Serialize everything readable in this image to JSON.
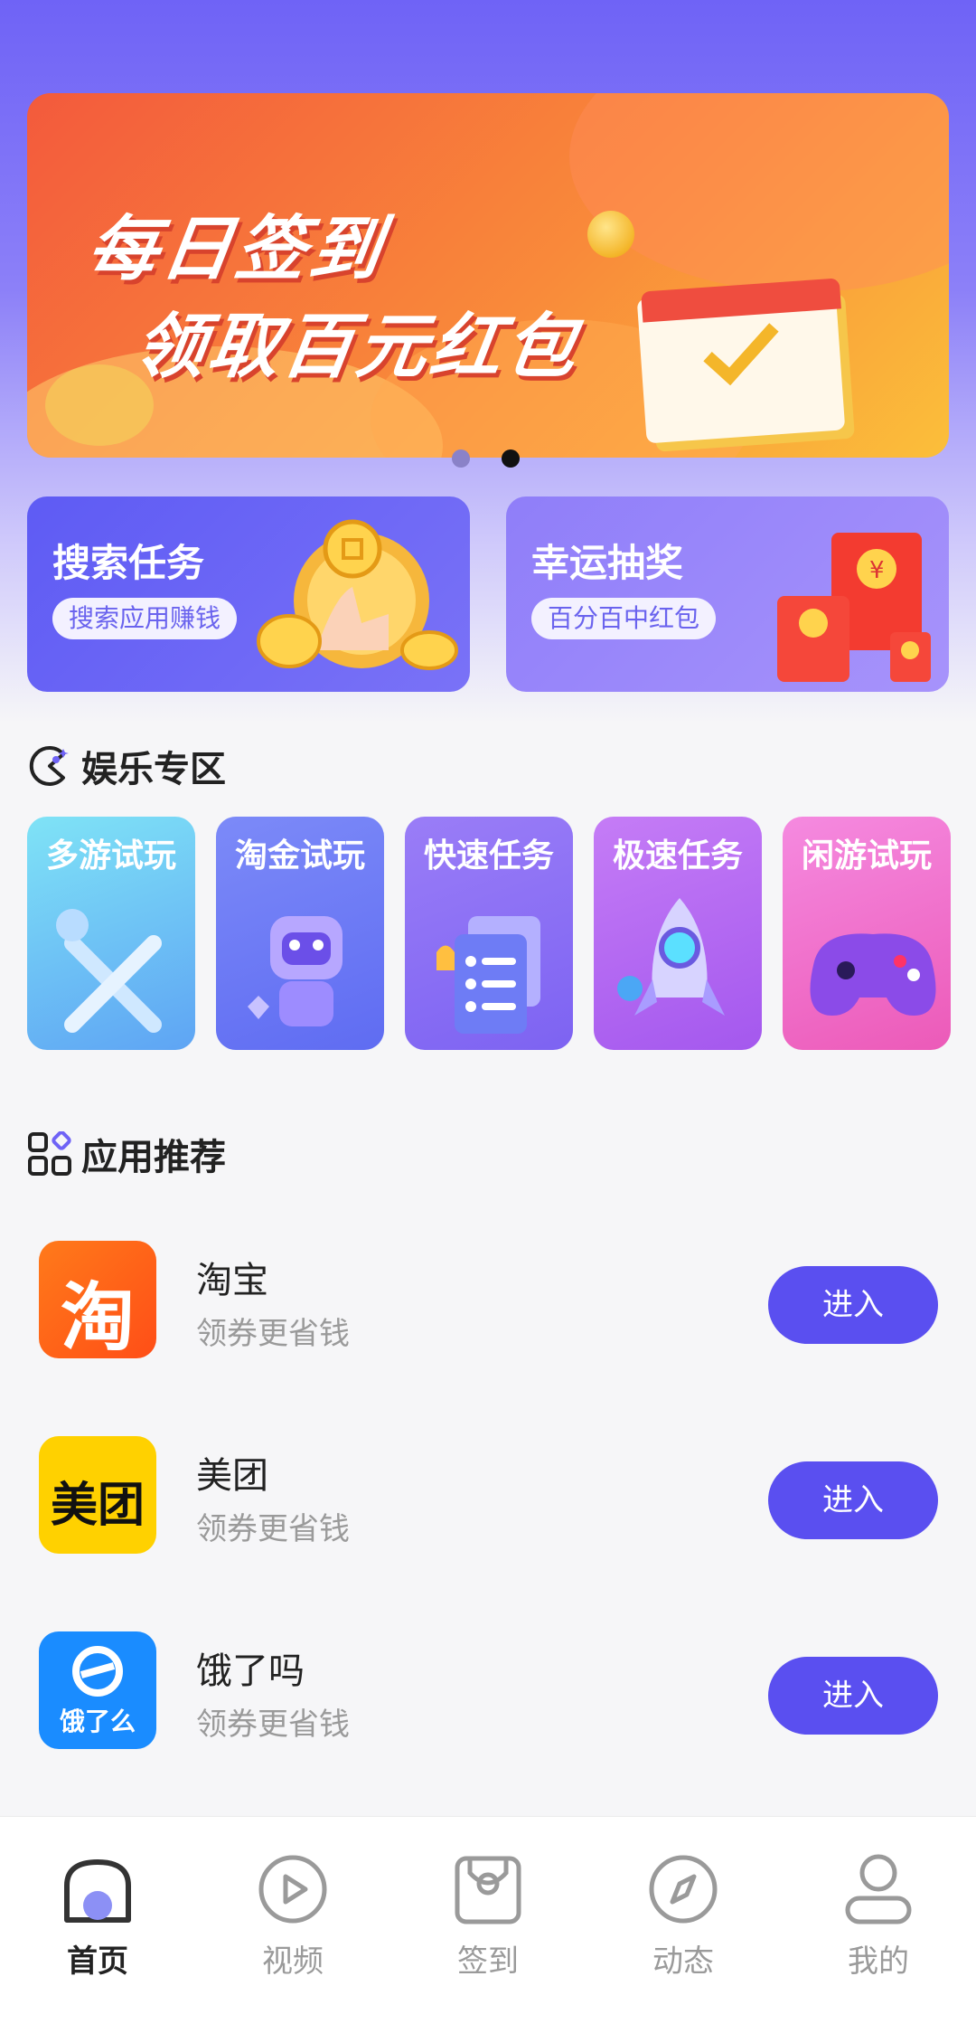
{
  "banner": {
    "line1": "每日签到",
    "line2": "领取百元红包",
    "pages": 2,
    "active_page": 2
  },
  "features": [
    {
      "title": "搜索任务",
      "pill": "搜索应用赚钱"
    },
    {
      "title": "幸运抽奖",
      "pill": "百分百中红包"
    }
  ],
  "entertainment": {
    "title": "娱乐专区",
    "tiles": [
      {
        "label": "多游试玩",
        "icon": "crossed-swords-icon"
      },
      {
        "label": "淘金试玩",
        "icon": "robot-mascot-icon"
      },
      {
        "label": "快速任务",
        "icon": "task-list-icon"
      },
      {
        "label": "极速任务",
        "icon": "rocket-icon"
      },
      {
        "label": "闲游试玩",
        "icon": "gamepad-icon"
      }
    ]
  },
  "apps": {
    "title": "应用推荐",
    "items": [
      {
        "name": "淘宝",
        "desc": "领券更省钱",
        "button": "进入",
        "logo_text": "淘",
        "color": "#ff5a1f"
      },
      {
        "name": "美团",
        "desc": "领券更省钱",
        "button": "进入",
        "logo_text": "美团",
        "color": "#ffd100"
      },
      {
        "name": "饿了吗",
        "desc": "领券更省钱",
        "button": "进入",
        "logo_text": "饿了么",
        "color": "#1a8cff"
      }
    ]
  },
  "tabbar": [
    {
      "label": "首页",
      "icon": "home-icon",
      "active": true
    },
    {
      "label": "视频",
      "icon": "play-icon",
      "active": false
    },
    {
      "label": "签到",
      "icon": "checkin-bag-icon",
      "active": false
    },
    {
      "label": "动态",
      "icon": "compass-icon",
      "active": false
    },
    {
      "label": "我的",
      "icon": "profile-icon",
      "active": false
    }
  ],
  "colors": {
    "primary": "#5a4ff0",
    "header_gradient_top": "#6f63f6",
    "banner_orange": "#f35a3c"
  }
}
